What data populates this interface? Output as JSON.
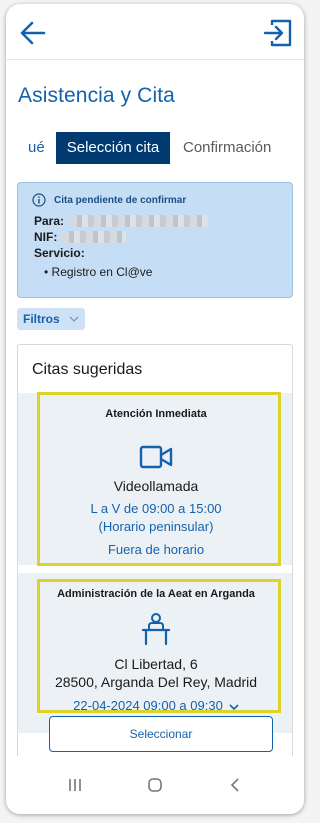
{
  "header": {
    "back_icon": "arrow-left-icon",
    "exit_icon": "logout-icon"
  },
  "page": {
    "title": "Asistencia y Cita"
  },
  "steps": {
    "previous": "ué",
    "active": "Selección cita",
    "next": "Confirmación"
  },
  "notice": {
    "icon": "info-icon",
    "heading": "Cita pendiente de confirmar",
    "para_label": "Para:",
    "nif_label": "NIF:",
    "servicio_label": "Servicio:",
    "servicio_item": "• Registro en Cl@ve"
  },
  "filters": {
    "label": "Filtros"
  },
  "suggestions": {
    "title": "Citas sugeridas",
    "cards": [
      {
        "header": "Atención Inmediata",
        "icon": "video-camera-icon",
        "mode": "Videollamada",
        "hours": "L a V de 09:00 a 15:00",
        "zone": "(Horario peninsular)",
        "status": "Fuera de horario"
      },
      {
        "header": "Administración de la Aeat en Arganda",
        "icon": "office-desk-icon",
        "address_line1": "Cl Libertad, 6",
        "address_line2": "28500, Arganda Del Rey, Madrid",
        "slot": "22-04-2024 09:00 a 09:30"
      }
    ],
    "select_label": "Seleccionar"
  },
  "system_nav": {
    "icons": [
      "recent-apps-icon",
      "home-icon",
      "back-nav-icon"
    ]
  },
  "colors": {
    "brand_blue": "#1462ad",
    "dark_blue": "#003a70",
    "notice_bg": "#c6def5",
    "highlight": "#dbd32a"
  }
}
